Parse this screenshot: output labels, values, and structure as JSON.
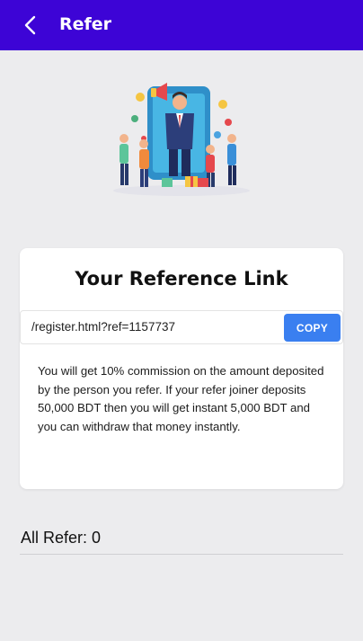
{
  "header": {
    "title": "Refer",
    "back_icon": "chevron-left-icon",
    "background_color": "#3d04d6"
  },
  "illustration": {
    "icon": "referral-marketing-illustration"
  },
  "reference_card": {
    "title": "Your Reference Link",
    "link_value": "/register.html?ref=1157737",
    "copy_label": "COPY",
    "copy_button_color": "#3a7ff0",
    "description": "You will get 10% commission on the amount deposited by the person you refer. If your refer joiner deposits 50,000 BDT then you will get instant 5,000 BDT and you can withdraw that money instantly."
  },
  "refer_summary": {
    "label": "All Refer: 0"
  }
}
